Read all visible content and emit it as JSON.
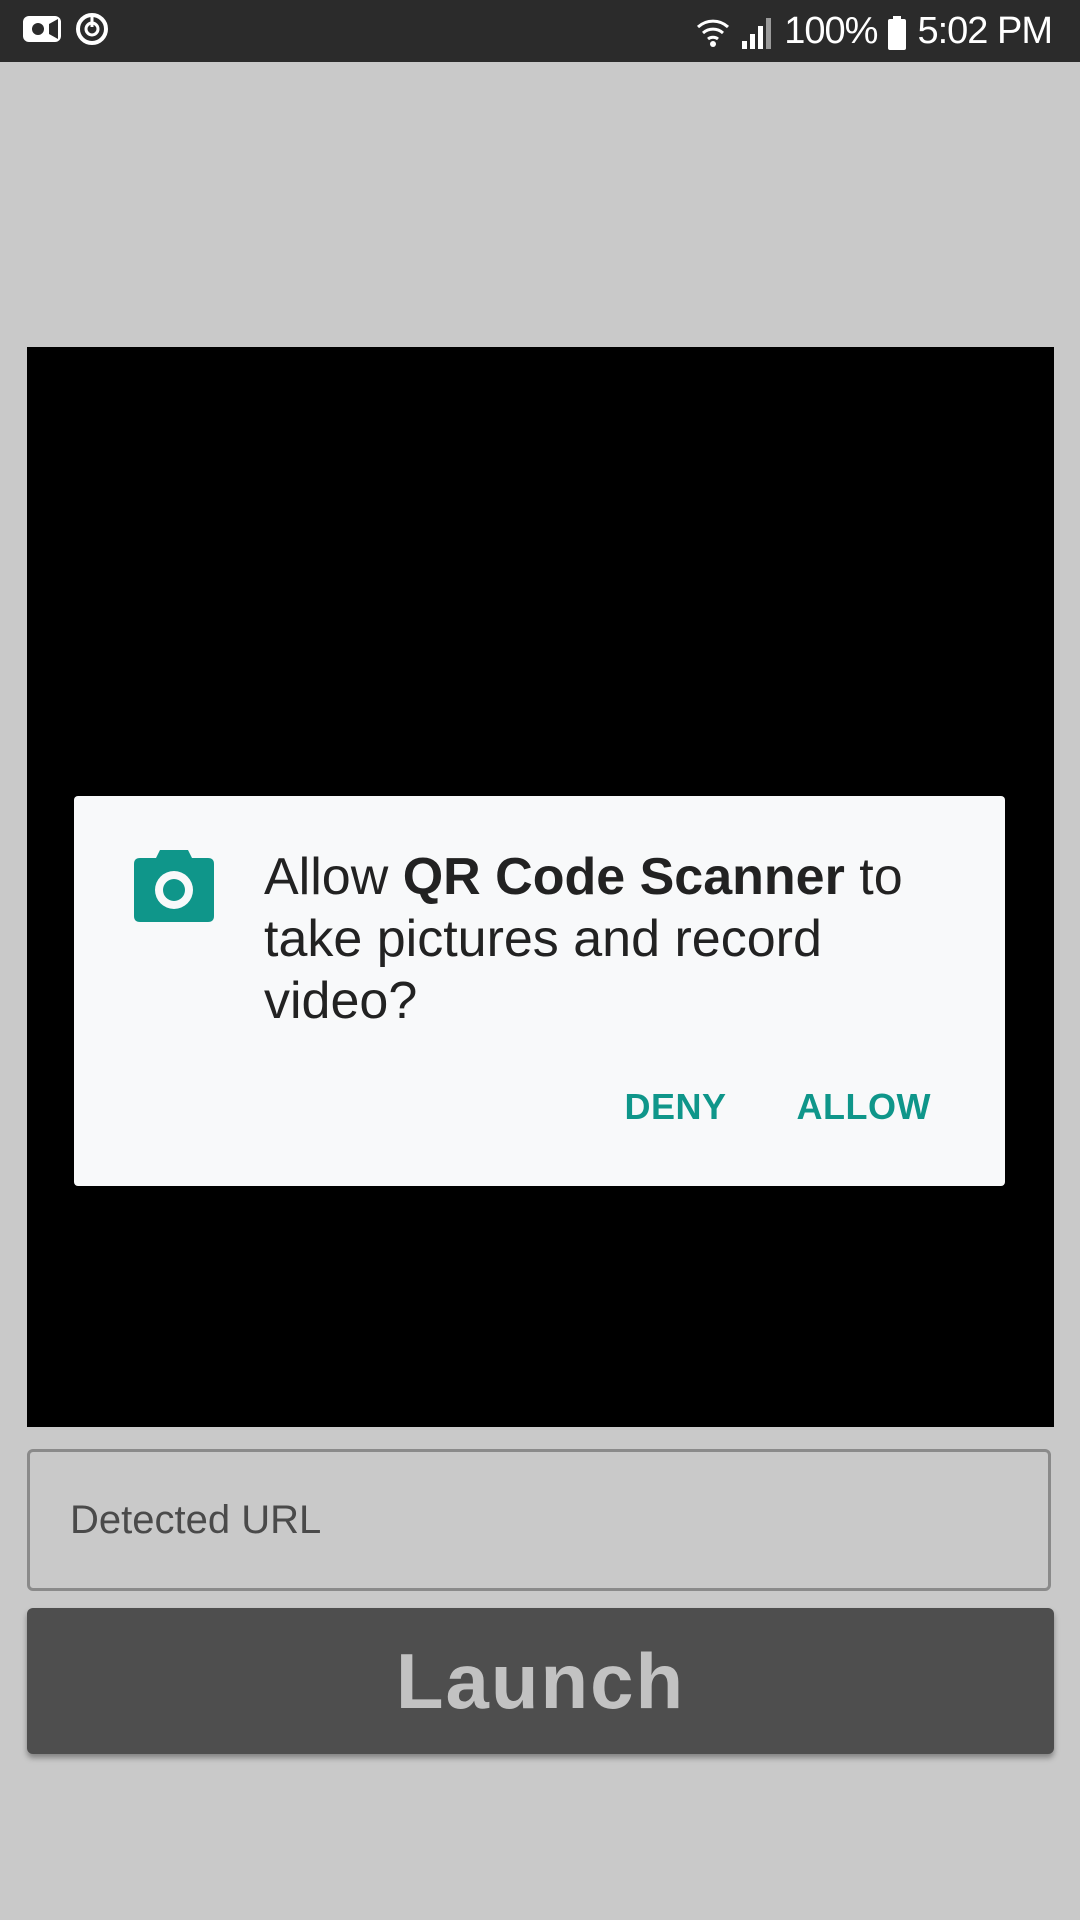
{
  "status_bar": {
    "left_icons": [
      "video-camera-icon",
      "data-saver-icon"
    ],
    "right_icons": [
      "wifi-icon",
      "signal-icon",
      "battery-icon"
    ],
    "battery_text": "100%",
    "time": "5:02 PM"
  },
  "camera_preview": {
    "background": "#000000"
  },
  "permission_dialog": {
    "icon": "camera-icon",
    "icon_color": "#0f968a",
    "message_prefix": "Allow ",
    "app_name": "QR Code Scanner",
    "message_suffix": " to take pictures and record video?",
    "deny_label": "DENY",
    "allow_label": "ALLOW",
    "accent_color": "#0f968a"
  },
  "url_field": {
    "placeholder": "Detected URL",
    "value": ""
  },
  "launch_button": {
    "label": "Launch"
  }
}
